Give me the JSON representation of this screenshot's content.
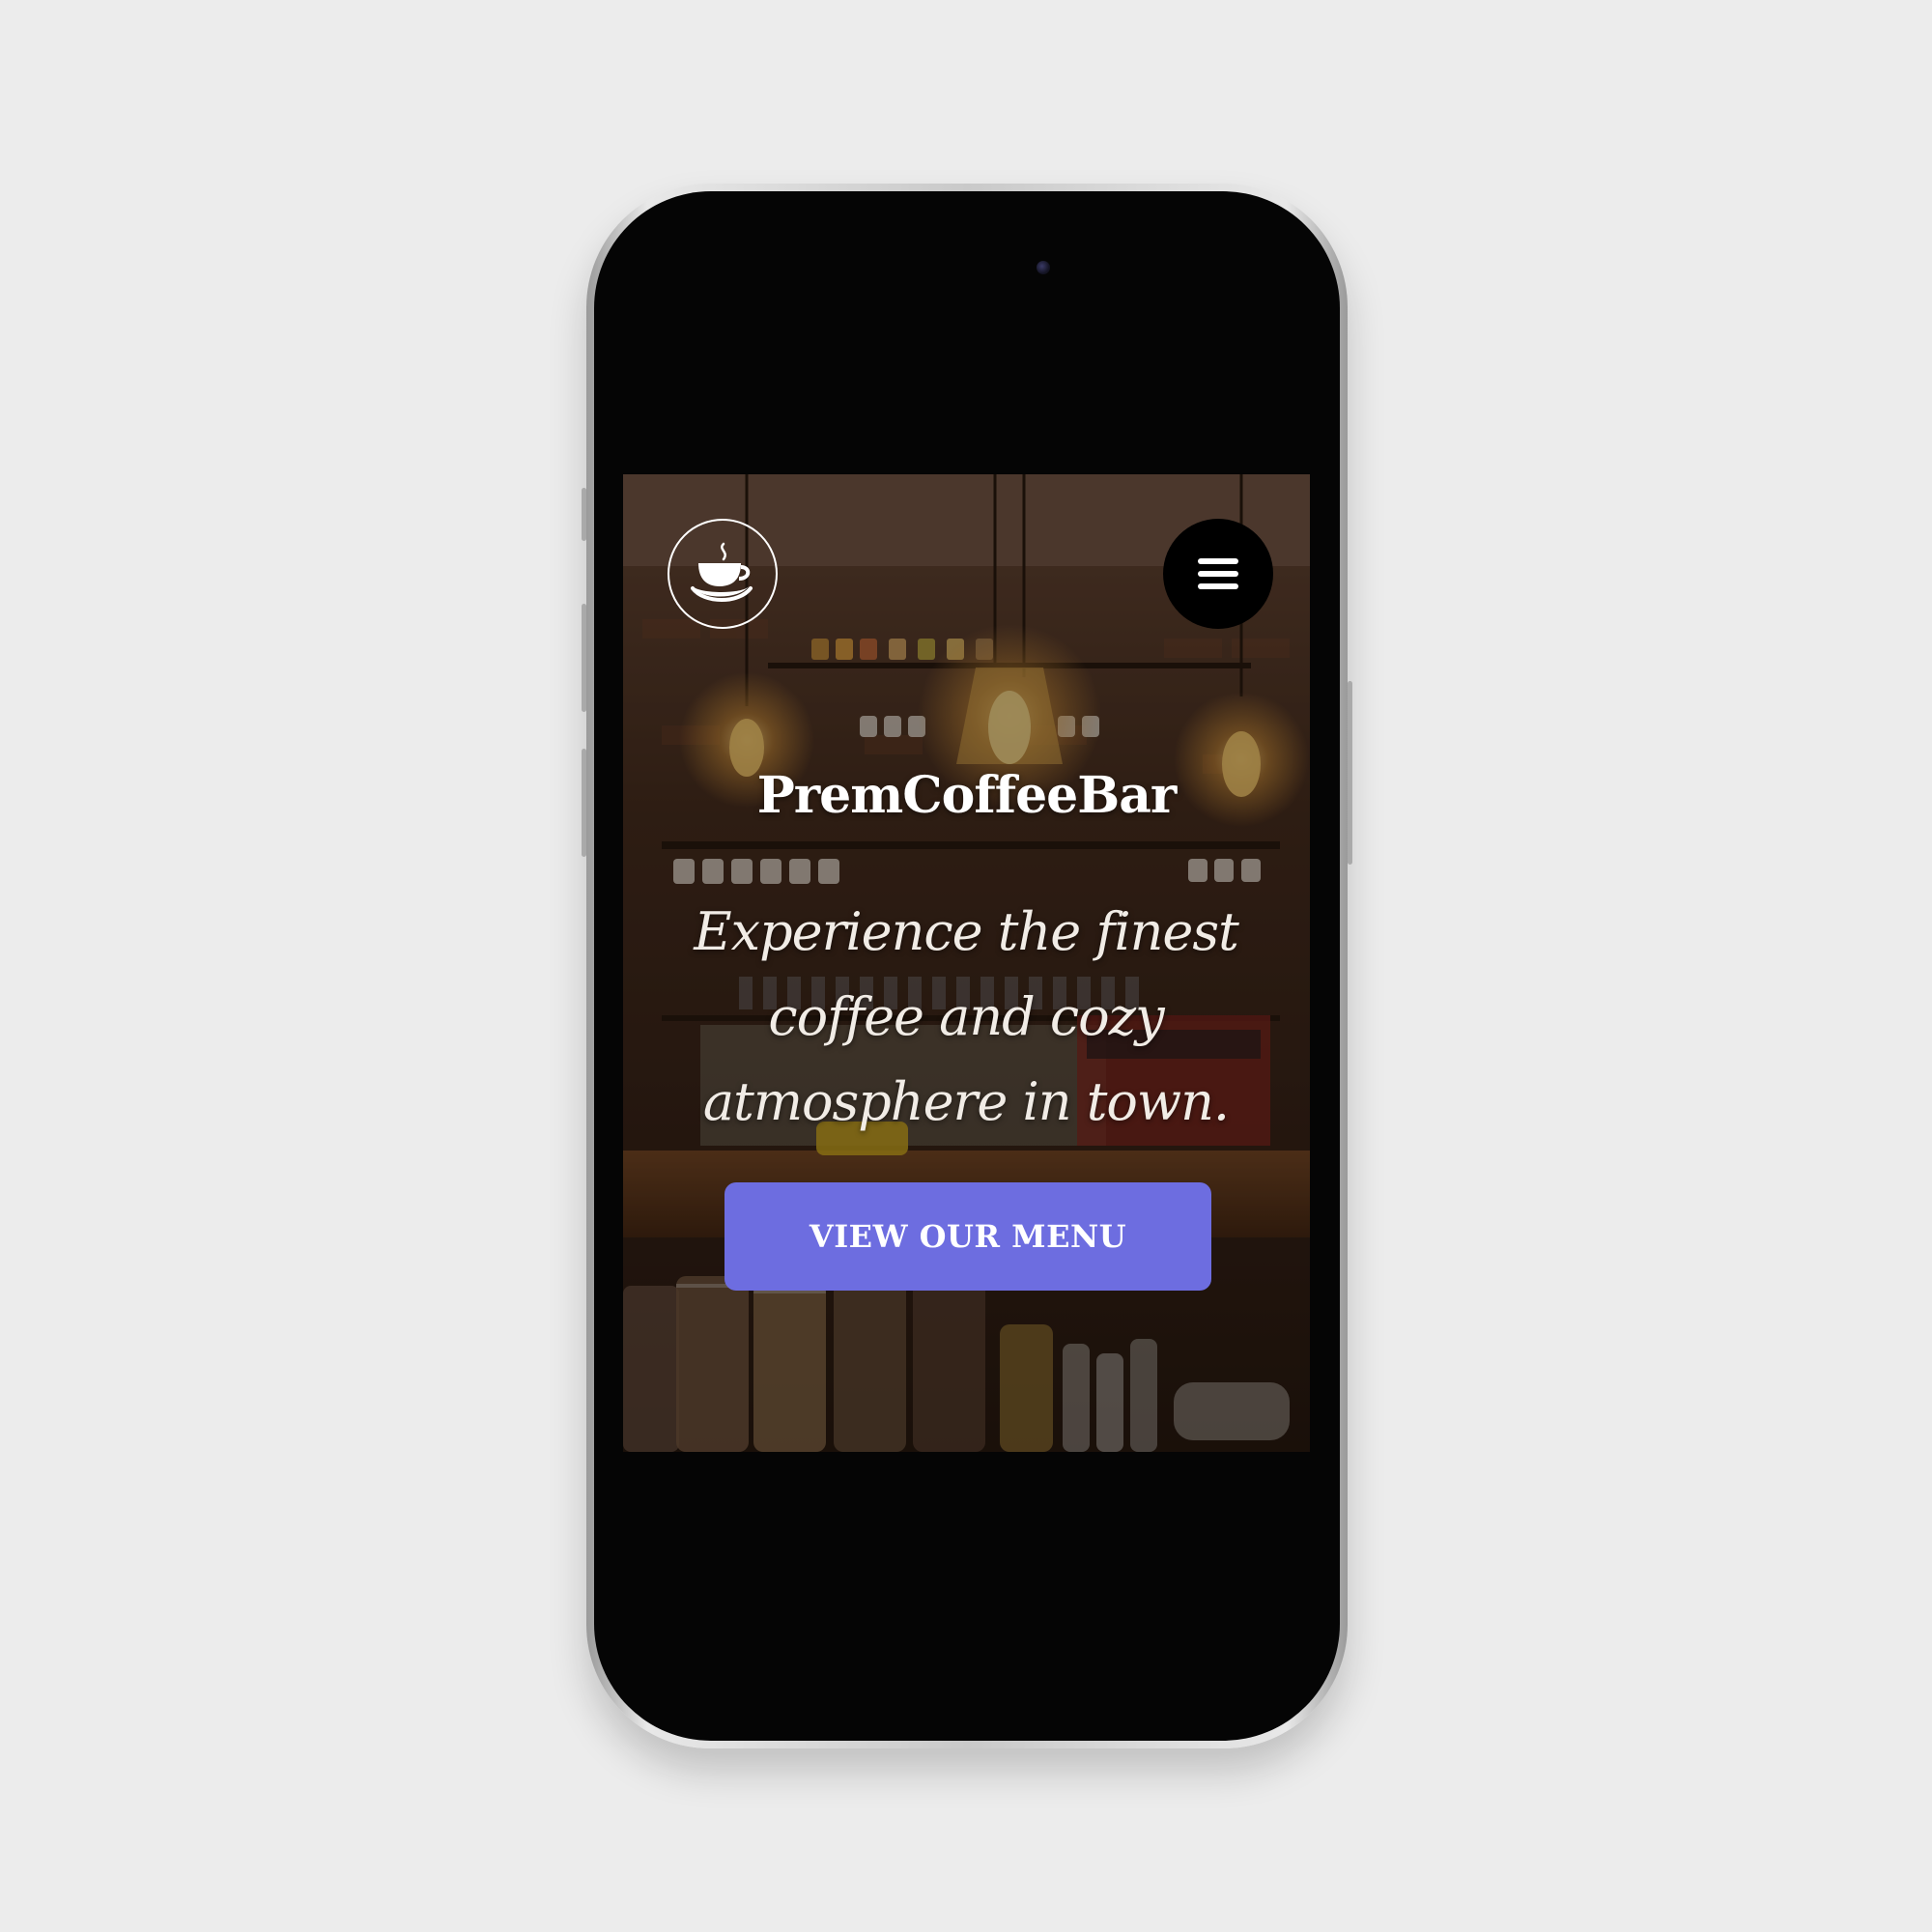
{
  "site": {
    "brand_name": "PremCoffeeBar",
    "tagline": "Experience the finest coffee and cozy atmosphere in town.",
    "cta_label": "VIEW OUR MENU"
  },
  "icons": {
    "logo": "coffee-cup-icon",
    "menu": "hamburger-menu-icon"
  },
  "colors": {
    "page_background": "#ececec",
    "cta_background": "#6d6de0",
    "menu_button_background": "#000000",
    "text": "#ffffff"
  }
}
